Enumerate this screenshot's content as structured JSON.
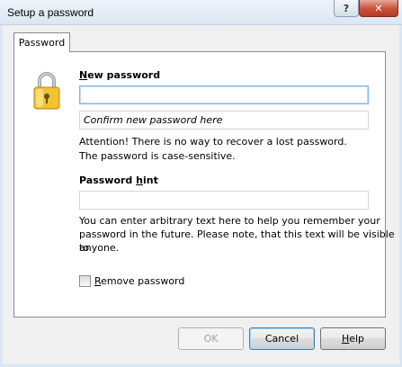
{
  "window": {
    "title": "Setup a password",
    "help_glyph": "?",
    "close_glyph": "✕"
  },
  "tabs": [
    {
      "label": "Password"
    }
  ],
  "icon": "lock-icon",
  "new_password": {
    "label_underlined": "N",
    "label_rest": "ew password",
    "value": "",
    "confirm_placeholder": "Confirm new password here"
  },
  "warning": {
    "line1": "Attention! There is no way to recover a lost password.",
    "line2": "The password is case-sensitive."
  },
  "hint": {
    "label_before": "Password ",
    "label_underlined": "h",
    "label_after": "int",
    "value": "",
    "description_line1": "You can enter arbitrary text here to help you remember your",
    "description_line2": "password in the future. Please note, that this text will be visible to",
    "description_line3": "anyone."
  },
  "remove_password": {
    "label_underlined": "R",
    "label_rest": "emove password",
    "checked": false
  },
  "buttons": {
    "ok": "OK",
    "cancel": "Cancel",
    "help_underlined": "H",
    "help_rest": "elp"
  },
  "colors": {
    "titlebar": "#dbe6f3",
    "close_button": "#c7503a",
    "lock_body": "#f2c230"
  }
}
